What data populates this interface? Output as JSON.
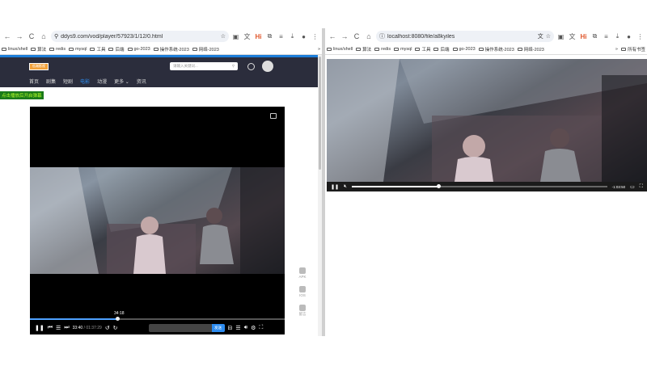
{
  "left": {
    "nav": {
      "back": "←",
      "forward": "→",
      "reload": "C",
      "home": "⌂"
    },
    "url": "ddys9.com/vod/player/57923/1/12/0.html",
    "bookmarks": [
      "linux/shell",
      "算法",
      "redis",
      "mysql",
      "工具",
      "后端",
      "go-2023",
      "操作系统-2023",
      "网络-2023"
    ],
    "bookmarks_more": "»",
    "site": {
      "logo_text": "低端影视",
      "search_placeholder": "请输入关键词...",
      "nav": [
        "首页",
        "剧集",
        "短剧",
        "电影",
        "动漫",
        "更多",
        "资讯"
      ],
      "active_nav": "电影",
      "notice": "点击播放后开启弹幕"
    },
    "player": {
      "time_tip": "34:18",
      "current_time": "33:40",
      "duration": "01:37:29",
      "progress": 0.343,
      "send_label": "发送"
    },
    "side_tools": [
      "APK",
      "IOS",
      "留言"
    ]
  },
  "right": {
    "nav": {
      "back": "←",
      "forward": "→",
      "reload": "C",
      "home": "⌂"
    },
    "url": "localhost:8080/file/a8kyiles",
    "bookmarks": [
      "linux/shell",
      "算法",
      "redis",
      "mysql",
      "工具",
      "后端",
      "go-2023",
      "操作系统-2023",
      "网络-2023"
    ],
    "bookmarks_more": "»",
    "bookmarks_all": "所有书签",
    "player": {
      "time_remaining": "-1:03:50",
      "progress": 0.34
    }
  }
}
